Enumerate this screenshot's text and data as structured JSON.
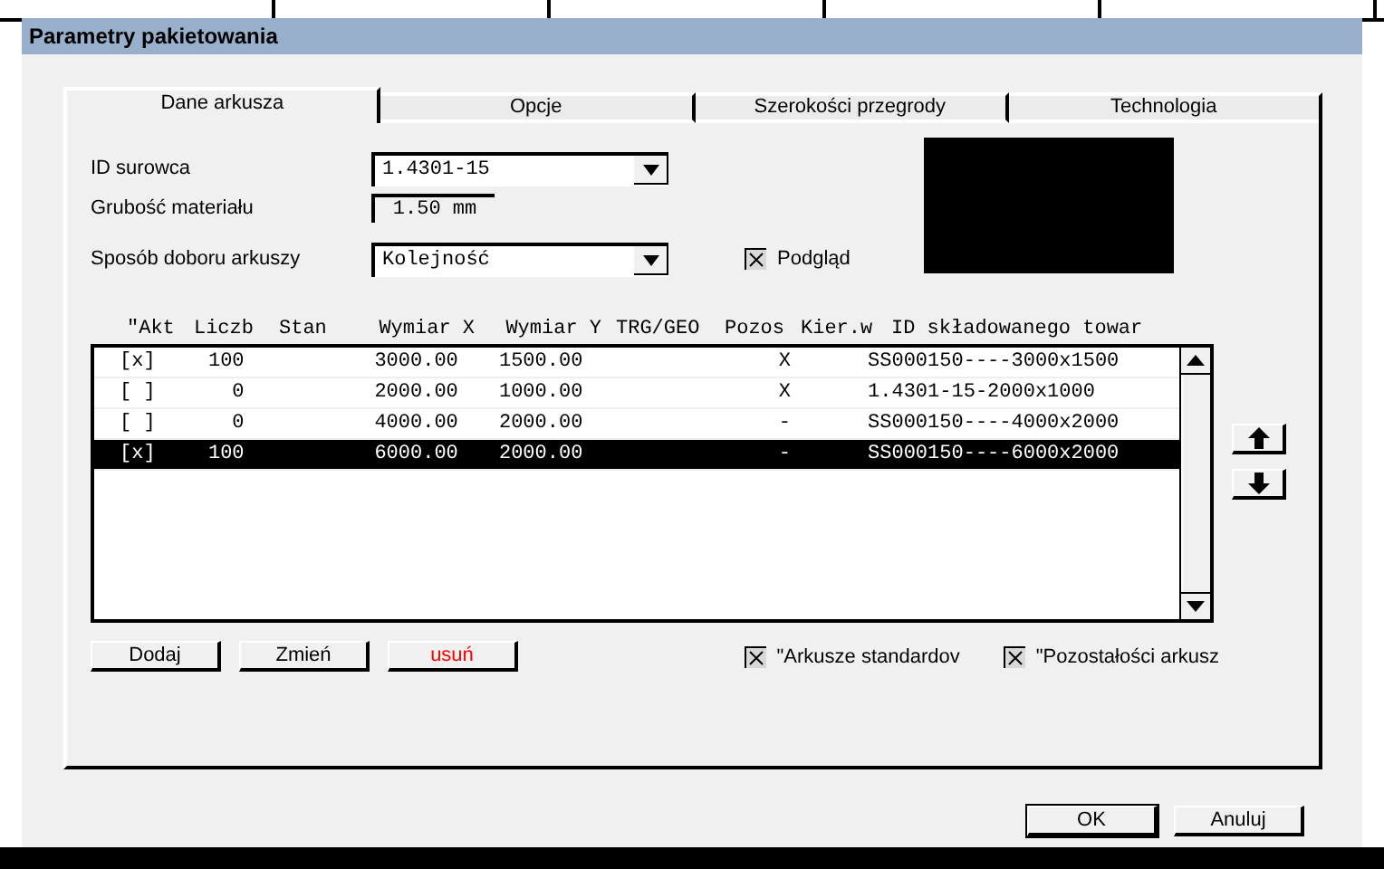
{
  "window": {
    "title": "Parametry pakietowania"
  },
  "tabs": [
    {
      "label": "Dane arkusza",
      "selected": true
    },
    {
      "label": "Opcje",
      "selected": false
    },
    {
      "label": "Szerokości przegrody",
      "selected": false
    },
    {
      "label": "Technologia",
      "selected": false
    }
  ],
  "form": {
    "material_id": {
      "label": "ID surowca",
      "value": "1.4301-15"
    },
    "thickness": {
      "label": "Grubość materiału",
      "value": "1.50 mm"
    },
    "selection_method": {
      "label": "Sposób doboru arkuszy",
      "value": "Kolejność"
    },
    "preview": {
      "label": "Podgląd",
      "checked": true
    }
  },
  "table": {
    "columns": [
      "\"Akt",
      "Liczb",
      "Stan",
      "Wymiar X",
      "Wymiar Y",
      "TRG/GEO",
      "Pozos",
      "Kier.w",
      "ID składowanego towar"
    ],
    "rows": [
      {
        "selected": false,
        "cells": [
          "[x]",
          "100",
          "",
          "3000.00",
          "1500.00",
          "",
          "",
          "X",
          "SS000150----3000x1500"
        ]
      },
      {
        "selected": false,
        "cells": [
          "[ ]",
          "0",
          "",
          "2000.00",
          "1000.00",
          "",
          "",
          "X",
          "1.4301-15-2000x1000"
        ]
      },
      {
        "selected": false,
        "cells": [
          "[ ]",
          "0",
          "",
          "4000.00",
          "2000.00",
          "",
          "",
          "-",
          "SS000150----4000x2000"
        ]
      },
      {
        "selected": true,
        "cells": [
          "[x]",
          "100",
          "",
          "6000.00",
          "2000.00",
          "",
          "",
          "-",
          "SS000150----6000x2000"
        ]
      }
    ]
  },
  "row_buttons": [
    {
      "label": "Dodaj",
      "danger": false
    },
    {
      "label": "Zmień",
      "danger": false
    },
    {
      "label": "usuń",
      "danger": true
    }
  ],
  "options": [
    {
      "label": "\"Arkusze standardov",
      "checked": true
    },
    {
      "label": "\"Pozostałości arkusz",
      "checked": true
    }
  ],
  "buttons": [
    "OK",
    "Anuluj"
  ]
}
